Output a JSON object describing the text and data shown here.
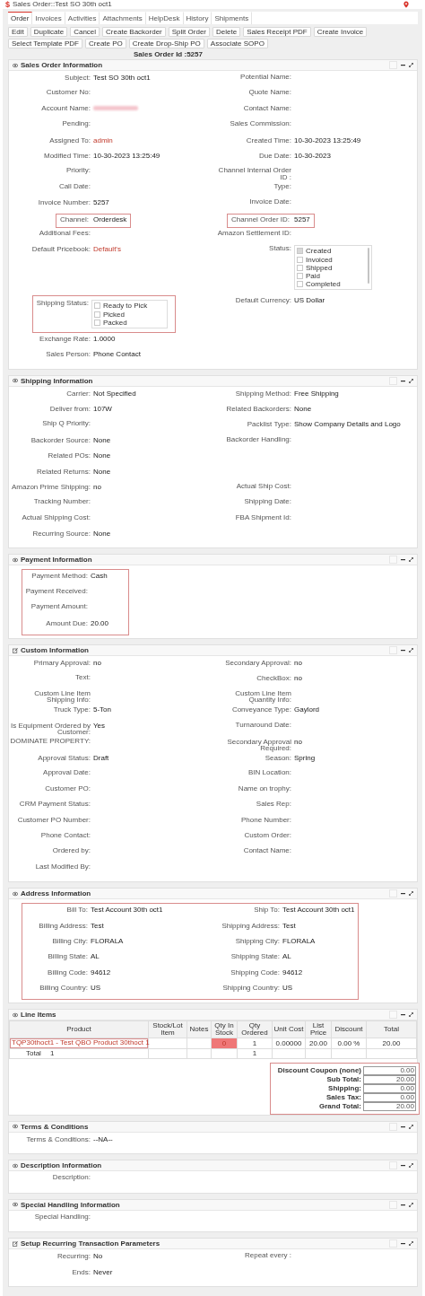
{
  "title_bar": {
    "icon": "$",
    "title": "Sales Order::Test SO 30th oct1"
  },
  "tabs": [
    {
      "label": "Order",
      "selected": true
    },
    {
      "label": "Invoices",
      "selected": false
    },
    {
      "label": "Activities",
      "selected": false
    },
    {
      "label": "Attachments",
      "selected": false
    },
    {
      "label": "HelpDesk",
      "selected": false
    },
    {
      "label": "History",
      "selected": false
    },
    {
      "label": "Shipments",
      "selected": false
    }
  ],
  "buttons": [
    "Edit",
    "Duplicate",
    "Cancel",
    "Create Backorder",
    "Split Order",
    "Delete",
    "Sales Receipt PDF",
    "Create Invoice",
    "Select Template PDF",
    "Create PO",
    "Create Drop-Ship PO",
    "Associate SOPO"
  ],
  "record_id": "Sales Order Id :5257",
  "sections": [
    {
      "title": "Sales Order Information",
      "editable": false,
      "kind": "fields",
      "rows": [
        [
          {
            "kind": "text",
            "label": "Subject:",
            "value": "Test SO 30th oct1"
          },
          {
            "kind": "text",
            "label": "Potential Name:"
          }
        ],
        [
          {
            "kind": "text",
            "label": "Customer No:"
          },
          {
            "kind": "text",
            "label": "Quote Name:"
          }
        ],
        [
          {
            "kind": "blurred",
            "label": "Account Name:"
          },
          {
            "kind": "text",
            "label": "Contact Name:"
          }
        ],
        [
          {
            "kind": "text",
            "label": "Pending:"
          },
          {
            "kind": "text",
            "label": "Sales Commission:"
          }
        ],
        [
          {
            "kind": "link",
            "label": "Assigned To:",
            "value": "admin"
          },
          {
            "kind": "text",
            "label": "Created Time:",
            "value": "10-30-2023 13:25:49"
          }
        ],
        [
          {
            "kind": "text",
            "label": "Modified Time:",
            "value": "10-30-2023 13:25:49"
          },
          {
            "kind": "text",
            "label": "Due Date:",
            "value": "10-30-2023"
          }
        ],
        [
          {
            "kind": "text",
            "label": "Priority:"
          },
          {
            "kind": "text",
            "label": "Channel Internal Order ID :"
          }
        ],
        [
          {
            "kind": "text",
            "label": "Call Date:"
          },
          {
            "kind": "text",
            "label": "Type:"
          }
        ],
        [
          {
            "kind": "text",
            "label": "Invoice Number:",
            "value": "5257"
          },
          {
            "kind": "text",
            "label": "Invoice Date:"
          }
        ],
        [
          {
            "kind": "text",
            "label": "Channel:",
            "value": "Orderdesk",
            "highlighted": true
          },
          {
            "kind": "text",
            "label": "Channel Order ID:",
            "value": "5257",
            "highlighted": true
          }
        ],
        [
          {
            "kind": "text",
            "label": "Additional Fees:"
          },
          {
            "kind": "text",
            "label": "Amazon Settlement ID:"
          }
        ],
        [
          {
            "kind": "link",
            "label": "Default Pricebook:",
            "value": "Default's"
          },
          {
            "kind": "checklist",
            "label": "Status:",
            "scrollable": true,
            "options": [
              {
                "label": "Created",
                "disabled": true
              },
              {
                "label": "Invoiced",
                "disabled": false
              },
              {
                "label": "Shipped",
                "disabled": false
              },
              {
                "label": "Paid",
                "disabled": false
              },
              {
                "label": "Completed",
                "disabled": false
              }
            ]
          }
        ],
        [
          {
            "kind": "checklist",
            "label": "Shipping Status:",
            "highlighted": true,
            "options": [
              {
                "label": "Ready to Pick",
                "disabled": false
              },
              {
                "label": "Picked",
                "disabled": false
              },
              {
                "label": "Packed",
                "disabled": false
              }
            ]
          },
          {
            "kind": "text",
            "label": "Default Currency:",
            "value": "US Dollar"
          }
        ],
        [
          {
            "kind": "text",
            "label": "Exchange Rate:",
            "value": "1.0000"
          }
        ],
        [
          {
            "kind": "text",
            "label": "Sales Person:",
            "value": "Phone Contact"
          }
        ]
      ]
    },
    {
      "title": "Shipping Information",
      "editable": false,
      "kind": "fields",
      "rows": [
        [
          {
            "kind": "text",
            "label": "Carrier:",
            "value": "Not Specified"
          },
          {
            "kind": "text",
            "label": "Shipping Method:",
            "value": "Free Shipping"
          }
        ],
        [
          {
            "kind": "text",
            "label": "Deliver from:",
            "value": "107W"
          },
          {
            "kind": "text",
            "label": "Related Backorders:",
            "value": "None"
          }
        ],
        [
          {
            "kind": "text",
            "label": "Ship Q Priority:"
          },
          {
            "kind": "text",
            "label": "Packlist Type:",
            "value": "Show Company Details and Logo"
          }
        ],
        [
          {
            "kind": "text",
            "label": "Backorder Source:",
            "value": "None"
          },
          {
            "kind": "text",
            "label": "Backorder Handling:"
          }
        ],
        [
          {
            "kind": "text",
            "label": "Related POs:",
            "value": "None"
          }
        ],
        [
          {
            "kind": "text",
            "label": "Related Returns:",
            "value": "None"
          }
        ],
        [
          {
            "kind": "text",
            "label": "Amazon Prime Shipping:",
            "value": "no"
          },
          {
            "kind": "text",
            "label": "Actual Ship Cost:"
          }
        ],
        [
          {
            "kind": "text",
            "label": "Tracking Number:"
          },
          {
            "kind": "text",
            "label": "Shipping Date:"
          }
        ],
        [
          {
            "kind": "text",
            "label": "Actual Shipping Cost:"
          },
          {
            "kind": "text",
            "label": "FBA Shipment Id:"
          }
        ],
        [
          {
            "kind": "text",
            "label": "Recurring Source:",
            "value": "None"
          }
        ]
      ]
    },
    {
      "title": "Payment Information",
      "editable": false,
      "kind": "fields",
      "highlighted": true,
      "rows": [
        [
          {
            "kind": "text",
            "label": "Payment Method:",
            "value": "Cash"
          }
        ],
        [
          {
            "kind": "text",
            "label": "Payment Received:"
          }
        ],
        [
          {
            "kind": "text",
            "label": "Payment Amount:"
          }
        ],
        [
          {
            "kind": "text",
            "label": "Amount Due:",
            "value": "20.00"
          }
        ]
      ]
    },
    {
      "title": "Custom Information",
      "editable": true,
      "kind": "fields",
      "rows": [
        [
          {
            "kind": "text",
            "label": "Primary Approval:",
            "value": "no"
          },
          {
            "kind": "text",
            "label": "Secondary Approval:",
            "value": "no"
          }
        ],
        [
          {
            "kind": "text",
            "label": "Text:"
          },
          {
            "kind": "text",
            "label": "CheckBox:",
            "value": "no"
          }
        ],
        [
          {
            "kind": "text",
            "label": "Custom Line Item Shipping Info:"
          },
          {
            "kind": "text",
            "label": "Custom Line Item Quantity Info:"
          }
        ],
        [
          {
            "kind": "text",
            "label": "Truck Type:",
            "value": "5-Ton"
          },
          {
            "kind": "text",
            "label": "Conveyance Type:",
            "value": "Gaylord"
          }
        ],
        [
          {
            "kind": "text",
            "label": "Is Equipment Ordered by Customer:",
            "value": "Yes"
          },
          {
            "kind": "text",
            "label": "Turnaround Date:"
          }
        ],
        [
          {
            "kind": "text",
            "label": "DOMINATE PROPERTY:"
          },
          {
            "kind": "text",
            "label": "Secondary Approval Required:",
            "value": "no"
          }
        ],
        [
          {
            "kind": "text",
            "label": "Approval Status:",
            "value": "Draft"
          },
          {
            "kind": "text",
            "label": "Season:",
            "value": "Spring"
          }
        ],
        [
          {
            "kind": "text",
            "label": "Approval Date:"
          },
          {
            "kind": "text",
            "label": "BIN Location:"
          }
        ],
        [
          {
            "kind": "text",
            "label": "Customer PO:"
          },
          {
            "kind": "text",
            "label": "Name on trophy:"
          }
        ],
        [
          {
            "kind": "text",
            "label": "CRM Payment Status:"
          },
          {
            "kind": "text",
            "label": "Sales Rep:"
          }
        ],
        [
          {
            "kind": "text",
            "label": "Customer PO Number:"
          },
          {
            "kind": "text",
            "label": "Phone Number:"
          }
        ],
        [
          {
            "kind": "text",
            "label": "Phone Contact:"
          },
          {
            "kind": "text",
            "label": "Custom Order:"
          }
        ],
        [
          {
            "kind": "text",
            "label": "Ordered by:"
          },
          {
            "kind": "text",
            "label": "Contact Name:"
          }
        ],
        [
          {
            "kind": "text",
            "label": "Last Modified By:"
          }
        ]
      ]
    },
    {
      "title": "Address Information",
      "editable": false,
      "kind": "fields",
      "highlighted": true,
      "rows": [
        [
          {
            "kind": "text",
            "label": "Bill To:",
            "value": "Test Account 30th oct1"
          },
          {
            "kind": "text",
            "label": "Ship To:",
            "value": "Test Account 30th oct1"
          }
        ],
        [
          {
            "kind": "text",
            "label": "Billing Address:",
            "value": "Test"
          },
          {
            "kind": "text",
            "label": "Shipping Address:",
            "value": "Test"
          }
        ],
        [
          {
            "kind": "text",
            "label": "Billing City:",
            "value": "FLORALA"
          },
          {
            "kind": "text",
            "label": "Shipping City:",
            "value": "FLORALA"
          }
        ],
        [
          {
            "kind": "text",
            "label": "Billing State:",
            "value": "AL"
          },
          {
            "kind": "text",
            "label": "Shipping State:",
            "value": "AL"
          }
        ],
        [
          {
            "kind": "text",
            "label": "Billing Code:",
            "value": "94612"
          },
          {
            "kind": "text",
            "label": "Shipping Code:",
            "value": "94612"
          }
        ],
        [
          {
            "kind": "text",
            "label": "Billing Country:",
            "value": "US"
          },
          {
            "kind": "text",
            "label": "Shipping Country:",
            "value": "US"
          }
        ]
      ]
    },
    {
      "title": "Line Items",
      "editable": false,
      "kind": "line_items",
      "columns": [
        "Product",
        "Stock/Lot Item",
        "Notes",
        "Qty In Stock",
        "Qty Ordered",
        "Unit Cost",
        "List Price",
        "Discount",
        "Total"
      ],
      "rows": [
        {
          "kind": "item",
          "product": "TQP30thoct1 - Test QBO Product 30thoct 1",
          "highlighted": true,
          "qty_in_stock": "0",
          "out_of_stock": true,
          "qty_ordered": "1",
          "unit_cost": "0.00000",
          "list_price": "20.00",
          "discount": "0.00 %",
          "total": "20.00"
        },
        {
          "kind": "total",
          "label": "Total",
          "count": "1",
          "qty_ordered": "1"
        }
      ],
      "totals_highlighted": true,
      "totals": [
        {
          "label": "Discount Coupon (none)",
          "value": "0.00"
        },
        {
          "label": "Sub Total:",
          "value": "20.00"
        },
        {
          "label": "Shipping:",
          "value": "0.00"
        },
        {
          "label": "Sales Tax:",
          "value": "0.00"
        },
        {
          "label": "Grand Total:",
          "value": "20.00"
        }
      ]
    },
    {
      "title": "Terms & Conditions",
      "editable": false,
      "kind": "fields",
      "rows": [
        [
          {
            "kind": "text",
            "label": "Terms & Conditions:",
            "value": "--NA--"
          }
        ]
      ]
    },
    {
      "title": "Description Information",
      "editable": false,
      "kind": "fields",
      "rows": [
        [
          {
            "kind": "text",
            "label": "Description:"
          }
        ]
      ]
    },
    {
      "title": "Special Handling Information",
      "editable": false,
      "kind": "fields",
      "rows": [
        [
          {
            "kind": "text",
            "label": "Special Handling:"
          }
        ]
      ]
    },
    {
      "title": "Setup Recurring Transaction Parameters",
      "editable": true,
      "kind": "fields",
      "rows": [
        [
          {
            "kind": "text",
            "label": "Recurring:",
            "value": "No"
          },
          {
            "kind": "text",
            "label": "Repeat every :"
          }
        ],
        [
          {
            "kind": "text",
            "label": "Ends:",
            "value": "Never"
          }
        ]
      ]
    }
  ]
}
